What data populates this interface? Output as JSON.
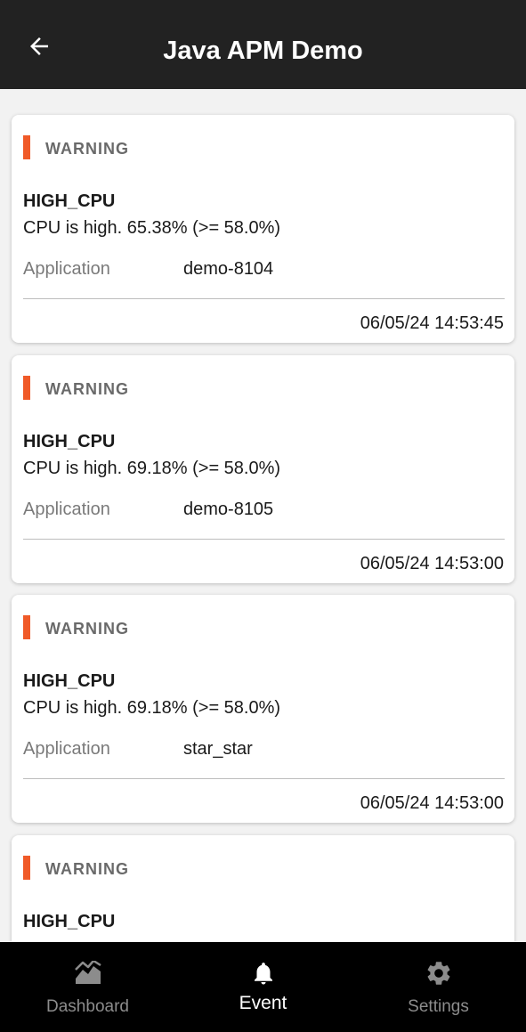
{
  "header": {
    "title": "Java APM Demo",
    "back_icon": "arrow-left-icon"
  },
  "colors": {
    "appbar": "#222222",
    "severity_warning": "#f05a28",
    "nav_active": "#ffffff",
    "nav_inactive": "#8c8c8c"
  },
  "events": [
    {
      "severity": "WARNING",
      "type": "HIGH_CPU",
      "message": "CPU is high. 65.38% (>= 58.0%)",
      "app_label": "Application",
      "app_value": "demo-8104",
      "timestamp": "06/05/24 14:53:45"
    },
    {
      "severity": "WARNING",
      "type": "HIGH_CPU",
      "message": "CPU is high. 69.18% (>= 58.0%)",
      "app_label": "Application",
      "app_value": "demo-8105",
      "timestamp": "06/05/24 14:53:00"
    },
    {
      "severity": "WARNING",
      "type": "HIGH_CPU",
      "message": "CPU is high. 69.18% (>= 58.0%)",
      "app_label": "Application",
      "app_value": "star_star",
      "timestamp": "06/05/24 14:53:00"
    },
    {
      "severity": "WARNING",
      "type": "HIGH_CPU"
    }
  ],
  "nav": {
    "items": [
      {
        "label": "Dashboard",
        "icon": "chart-icon",
        "active": false
      },
      {
        "label": "Event",
        "icon": "bell-icon",
        "active": true
      },
      {
        "label": "Settings",
        "icon": "gear-icon",
        "active": false
      }
    ]
  }
}
